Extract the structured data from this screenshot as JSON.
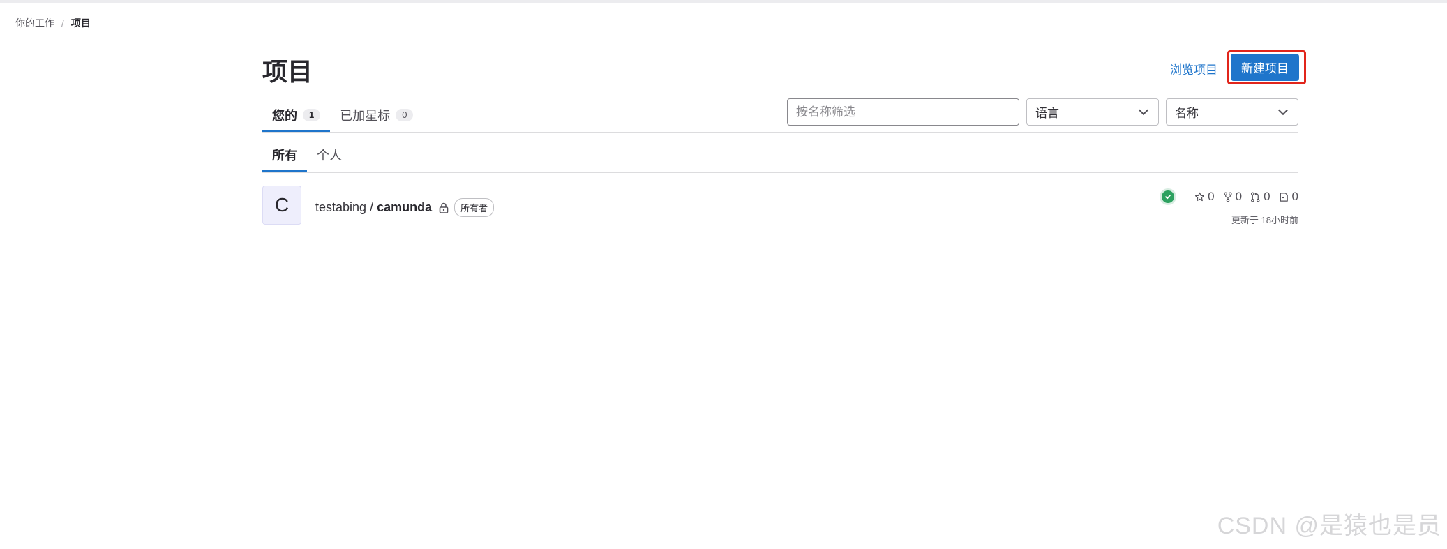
{
  "breadcrumb": {
    "parent": "你的工作",
    "separator": "/",
    "current": "项目"
  },
  "header": {
    "title": "项目",
    "browse_link": "浏览项目",
    "new_button": "新建项目"
  },
  "tabs": [
    {
      "label": "您的",
      "count": "1",
      "active": true
    },
    {
      "label": "已加星标",
      "count": "0",
      "active": false
    }
  ],
  "filters": {
    "search_placeholder": "按名称筛选",
    "language_select": "语言",
    "sort_select": "名称"
  },
  "subtabs": [
    {
      "label": "所有",
      "active": true
    },
    {
      "label": "个人",
      "active": false
    }
  ],
  "projects": [
    {
      "avatar_letter": "C",
      "namespace": "testabing",
      "separator": "/",
      "name": "camunda",
      "visibility_icon": "lock-icon",
      "role": "所有者",
      "pipeline_status": "success",
      "stars": "0",
      "forks": "0",
      "merge_requests": "0",
      "issues": "0",
      "updated": "更新于 18小时前"
    }
  ],
  "watermark": "CSDN @是猿也是员",
  "colors": {
    "accent": "#1f75cb",
    "highlight_border": "#e1251b",
    "pipeline_success": "#2da160"
  }
}
